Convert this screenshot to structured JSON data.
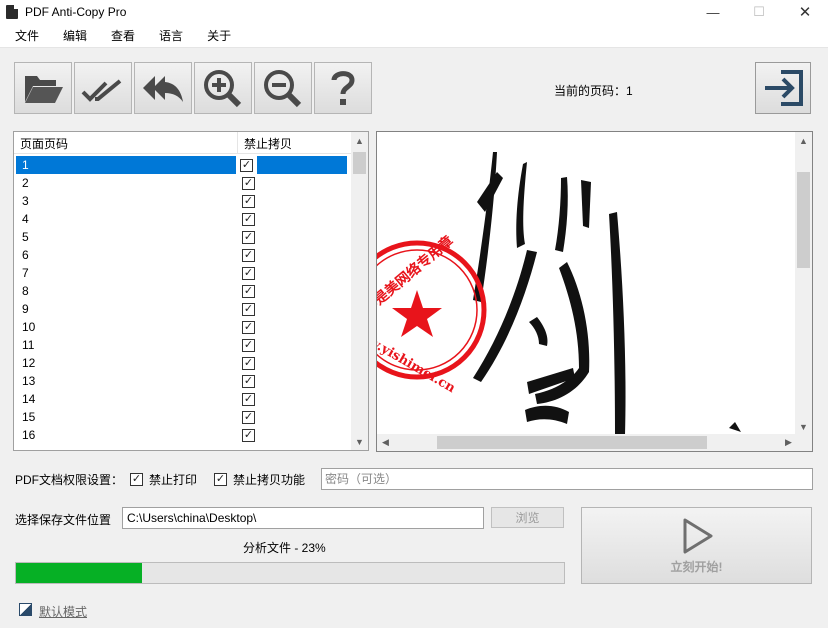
{
  "window": {
    "title": "PDF Anti-Copy Pro",
    "minimize": "—",
    "maximize": "☐",
    "close": "✕"
  },
  "menu": [
    "文件",
    "编辑",
    "查看",
    "语言",
    "关于"
  ],
  "toolbar": {
    "buttons": [
      "open-folder",
      "check-all",
      "undo-all",
      "zoom-in",
      "zoom-out",
      "help"
    ]
  },
  "current_page": {
    "label": "当前的页码：1"
  },
  "list": {
    "headers": [
      "页面页码",
      "禁止拷贝"
    ],
    "rows": [
      {
        "page": "1",
        "checked": true
      },
      {
        "page": "2",
        "checked": true
      },
      {
        "page": "3",
        "checked": true
      },
      {
        "page": "4",
        "checked": true
      },
      {
        "page": "5",
        "checked": true
      },
      {
        "page": "6",
        "checked": true
      },
      {
        "page": "7",
        "checked": true
      },
      {
        "page": "8",
        "checked": true
      },
      {
        "page": "9",
        "checked": true
      },
      {
        "page": "10",
        "checked": true
      },
      {
        "page": "11",
        "checked": true
      },
      {
        "page": "12",
        "checked": true
      },
      {
        "page": "13",
        "checked": true
      },
      {
        "page": "14",
        "checked": true
      },
      {
        "page": "15",
        "checked": true
      },
      {
        "page": "16",
        "checked": true
      }
    ],
    "selected_index": 0
  },
  "preview": {
    "stamp_text": "亦是美网络专用章",
    "stamp_url": "www.yishimei.cn"
  },
  "permissions": {
    "label": "PDF文档权限设置：",
    "no_print": "禁止打印",
    "no_copy": "禁止拷贝功能",
    "password_placeholder": "密码（可选）"
  },
  "save": {
    "label": "选择保存文件位置",
    "path": "C:\\Users\\china\\Desktop\\",
    "browse": "浏览"
  },
  "start": {
    "label": "立刻开始!"
  },
  "status": {
    "text": "分析文件 - 23%",
    "progress": 0.23
  },
  "mode": {
    "label": "默认模式"
  },
  "colors": {
    "selection": "#0078d7",
    "progress": "#06b025",
    "stamp": "#e8141b"
  }
}
